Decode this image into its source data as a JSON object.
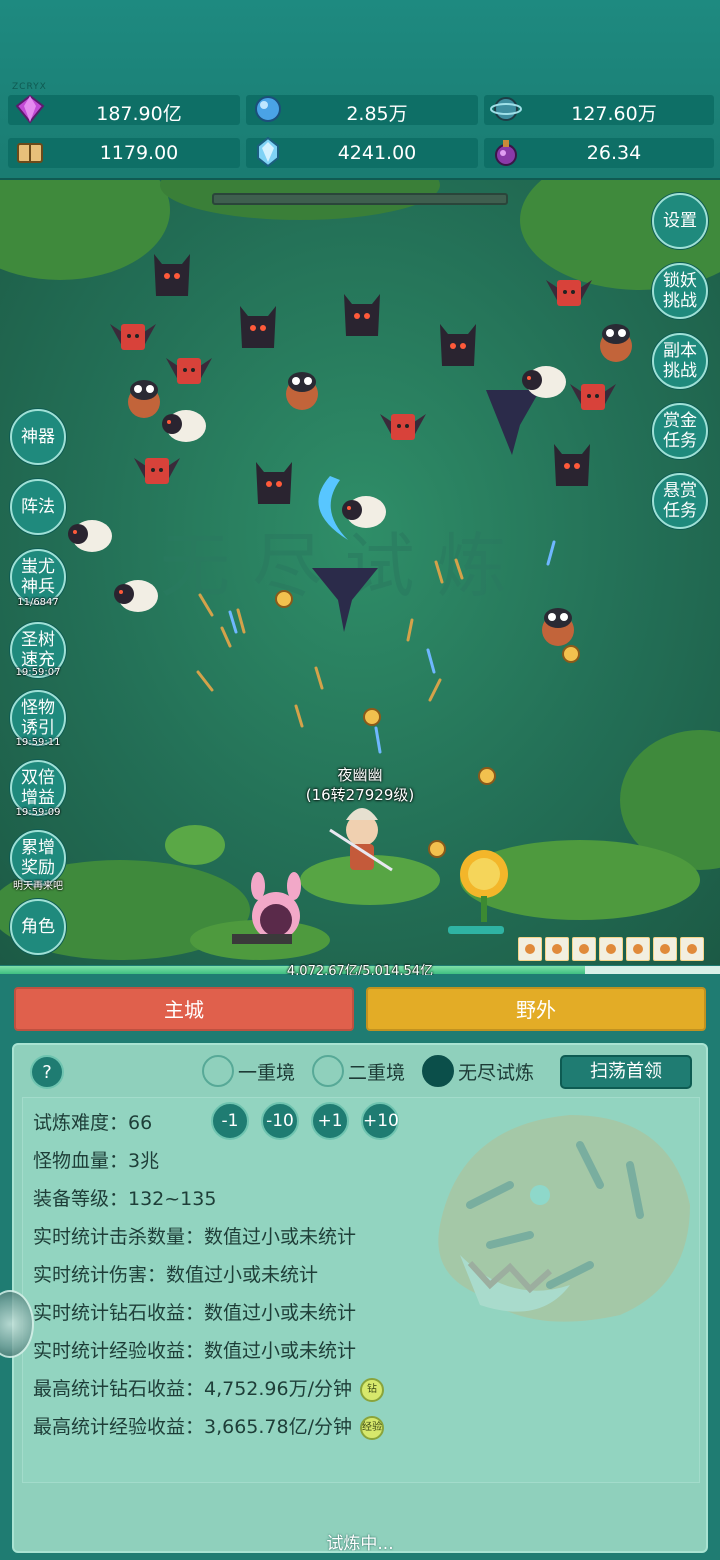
{
  "header": {
    "watermark": "ZCRYX",
    "resources": [
      {
        "icon": "purple-diamond-icon",
        "value": "187.90亿"
      },
      {
        "icon": "blue-crystal-ball-icon",
        "value": "2.85万"
      },
      {
        "icon": "planet-orb-icon",
        "value": "127.60万"
      },
      {
        "icon": "spell-book-icon",
        "value": "1179.00"
      },
      {
        "icon": "ice-crystal-icon",
        "value": "4241.00"
      },
      {
        "icon": "purple-potion-icon",
        "value": "26.34"
      }
    ]
  },
  "right_menu": {
    "settings": "设置",
    "lock_demon": [
      "锁妖",
      "挑战"
    ],
    "dungeon": [
      "副本",
      "挑战"
    ],
    "bounty_gold": [
      "赏金",
      "任务"
    ],
    "wanted": [
      "悬赏",
      "任务"
    ]
  },
  "left_menu": {
    "artifact": "神器",
    "formation": "阵法",
    "chiyou": {
      "lines": [
        "蚩尤",
        "神兵"
      ],
      "timer": "11/6847"
    },
    "holy_tree": {
      "lines": [
        "圣树",
        "速充"
      ],
      "timer": "19:59:07"
    },
    "monster_lure": {
      "lines": [
        "怪物",
        "诱引"
      ],
      "timer": "19:59:11"
    },
    "double_gain": {
      "lines": [
        "双倍",
        "增益"
      ],
      "timer": "19:59:09"
    },
    "accum_reward": {
      "lines": [
        "累增",
        "奖励"
      ],
      "timer": "明天再来吧"
    },
    "character": "角色"
  },
  "battle": {
    "player_name": "夜幽幽",
    "player_level": "(16转27929级)",
    "buff_icons": 7
  },
  "progress": {
    "text": "4,072.67亿/5,014.54亿",
    "fraction": 0.812
  },
  "nav": {
    "main_city": "主城",
    "wild": "野外"
  },
  "trial": {
    "help": "?",
    "modes": [
      {
        "label": "一重境",
        "selected": false
      },
      {
        "label": "二重境",
        "selected": false
      },
      {
        "label": "无尽试炼",
        "selected": true
      }
    ],
    "sweep_button": "扫荡首领",
    "difficulty_label": "试炼难度：",
    "difficulty_value": "66",
    "adjust_buttons": [
      "-1",
      "-10",
      "+1",
      "+10"
    ],
    "monster_hp": "怪物血量：3兆",
    "equip_level": "装备等级：132~135",
    "kills": "实时统计击杀数量：数值过小或未统计",
    "damage": "实时统计伤害：数值过小或未统计",
    "diamond_income": "实时统计钻石收益：数值过小或未统计",
    "exp_income": "实时统计经验收益：数值过小或未统计",
    "max_diamond": "最高统计钻石收益：4,752.96万/分钟",
    "max_diamond_tag": "钻",
    "max_exp": "最高统计经验收益：3,665.78亿/分钟",
    "max_exp_tag": "经验",
    "status": "试炼中..."
  },
  "colors": {
    "header_bg": "#1e8a80",
    "field_bg": "#236f56",
    "city_button": "#e0604c",
    "wild_button": "#e3ac26",
    "panel_bg": "#8fd0bc"
  }
}
